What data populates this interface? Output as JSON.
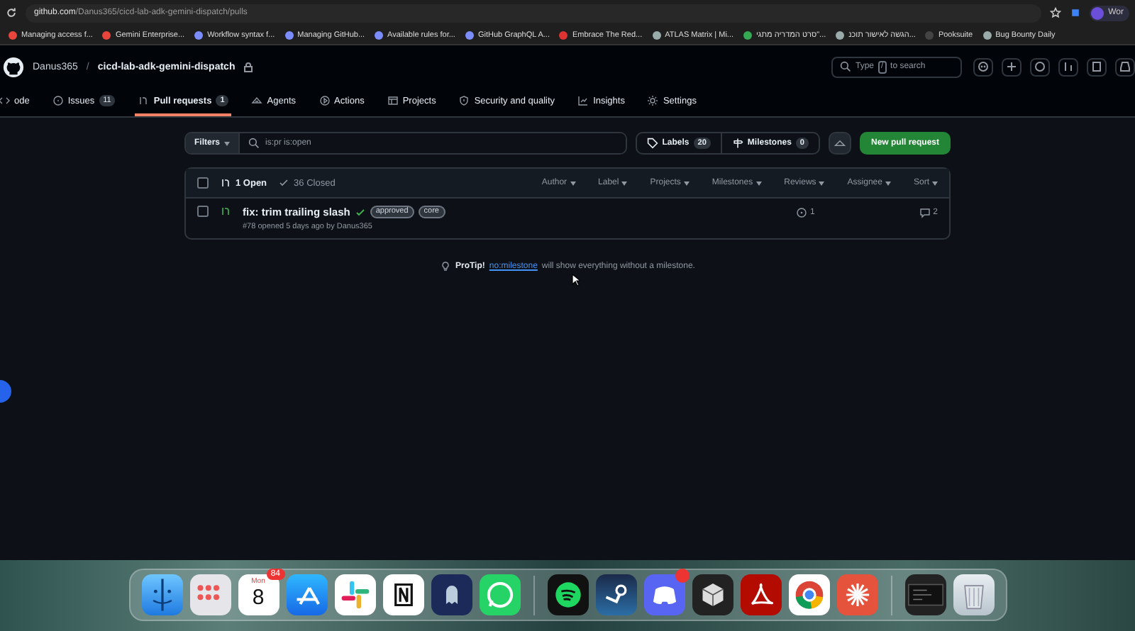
{
  "browser": {
    "url_host": "github.com",
    "url_path": "/Danus365/cicd-lab-adk-gemini-dispatch/pulls",
    "profile": "Wor",
    "bookmarks": [
      {
        "title": "Managing access f...",
        "kind": "google"
      },
      {
        "title": "Gemini Enterprise...",
        "kind": "google"
      },
      {
        "title": "Workflow syntax f...",
        "kind": "github"
      },
      {
        "title": "Managing GitHub...",
        "kind": "github"
      },
      {
        "title": "Available rules for...",
        "kind": "github"
      },
      {
        "title": "GitHub GraphQL A...",
        "kind": "github"
      },
      {
        "title": "Embrace The Red...",
        "kind": "red"
      },
      {
        "title": "ATLAS Matrix | Mi...",
        "kind": "globe"
      },
      {
        "title": "סרט המדריה מתגי\"...",
        "kind": "drive"
      },
      {
        "title": "הגשה לאישור תוכנ...",
        "kind": "globe"
      },
      {
        "title": "Pooksuite",
        "kind": "folder"
      },
      {
        "title": "Bug Bounty Daily",
        "kind": "globe"
      }
    ]
  },
  "repo": {
    "owner": "Danus365",
    "separator": "/",
    "name": "cicd-lab-adk-gemini-dispatch"
  },
  "search": {
    "before": "Type",
    "key": "/",
    "after": "to search"
  },
  "nav": [
    {
      "label": "ode",
      "kind": "code",
      "selected": false
    },
    {
      "label": "Issues",
      "count": "11",
      "kind": "issue",
      "selected": false
    },
    {
      "label": "Pull requests",
      "count": "1",
      "kind": "pr",
      "selected": true
    },
    {
      "label": "Agents",
      "kind": "agent",
      "selected": false
    },
    {
      "label": "Actions",
      "kind": "play",
      "selected": false
    },
    {
      "label": "Projects",
      "kind": "table",
      "selected": false
    },
    {
      "label": "Security and quality",
      "kind": "shield",
      "selected": false
    },
    {
      "label": "Insights",
      "kind": "graph",
      "selected": false
    },
    {
      "label": "Settings",
      "kind": "gear",
      "selected": false
    }
  ],
  "filters": {
    "button": "Filters",
    "query": "is:pr is:open",
    "labels": "Labels",
    "labels_count": "20",
    "milestones": "Milestones",
    "milestones_count": "0",
    "new_button": "New pull request"
  },
  "list": {
    "select_all_checked": false,
    "states": [
      {
        "label": "1 Open",
        "selected": true
      },
      {
        "label": "36 Closed",
        "selected": false
      }
    ],
    "sorts": [
      "Author",
      "Label",
      "Projects",
      "Milestones",
      "Reviews",
      "Assignee",
      "Sort"
    ],
    "rows": [
      {
        "checked": false,
        "title": "fix: trim trailing slash",
        "checks_passed": true,
        "labels": [
          {
            "name": "approved"
          },
          {
            "name": "core"
          }
        ],
        "meta": "#78 opened 5 days ago by Danus365",
        "linked": "1",
        "comments": "2"
      }
    ]
  },
  "tip": {
    "lead": "ProTip!",
    "link": "no:milestone",
    "rest": "will show everything without a milestone."
  },
  "dock": [
    {
      "kind": "finder"
    },
    {
      "kind": "launchpad"
    },
    {
      "kind": "calendar",
      "month": "Mon",
      "day": "8",
      "badge": "84"
    },
    {
      "kind": "appstore"
    },
    {
      "kind": "slack"
    },
    {
      "kind": "notion"
    },
    {
      "kind": "game"
    },
    {
      "kind": "whatsapp"
    },
    {
      "kind": "sep"
    },
    {
      "kind": "spotify"
    },
    {
      "kind": "steam"
    },
    {
      "kind": "discord",
      "dot": true
    },
    {
      "kind": "cube"
    },
    {
      "kind": "acrobat"
    },
    {
      "kind": "chrome"
    },
    {
      "kind": "burst"
    },
    {
      "kind": "sep"
    },
    {
      "kind": "window"
    },
    {
      "kind": "trash"
    }
  ]
}
